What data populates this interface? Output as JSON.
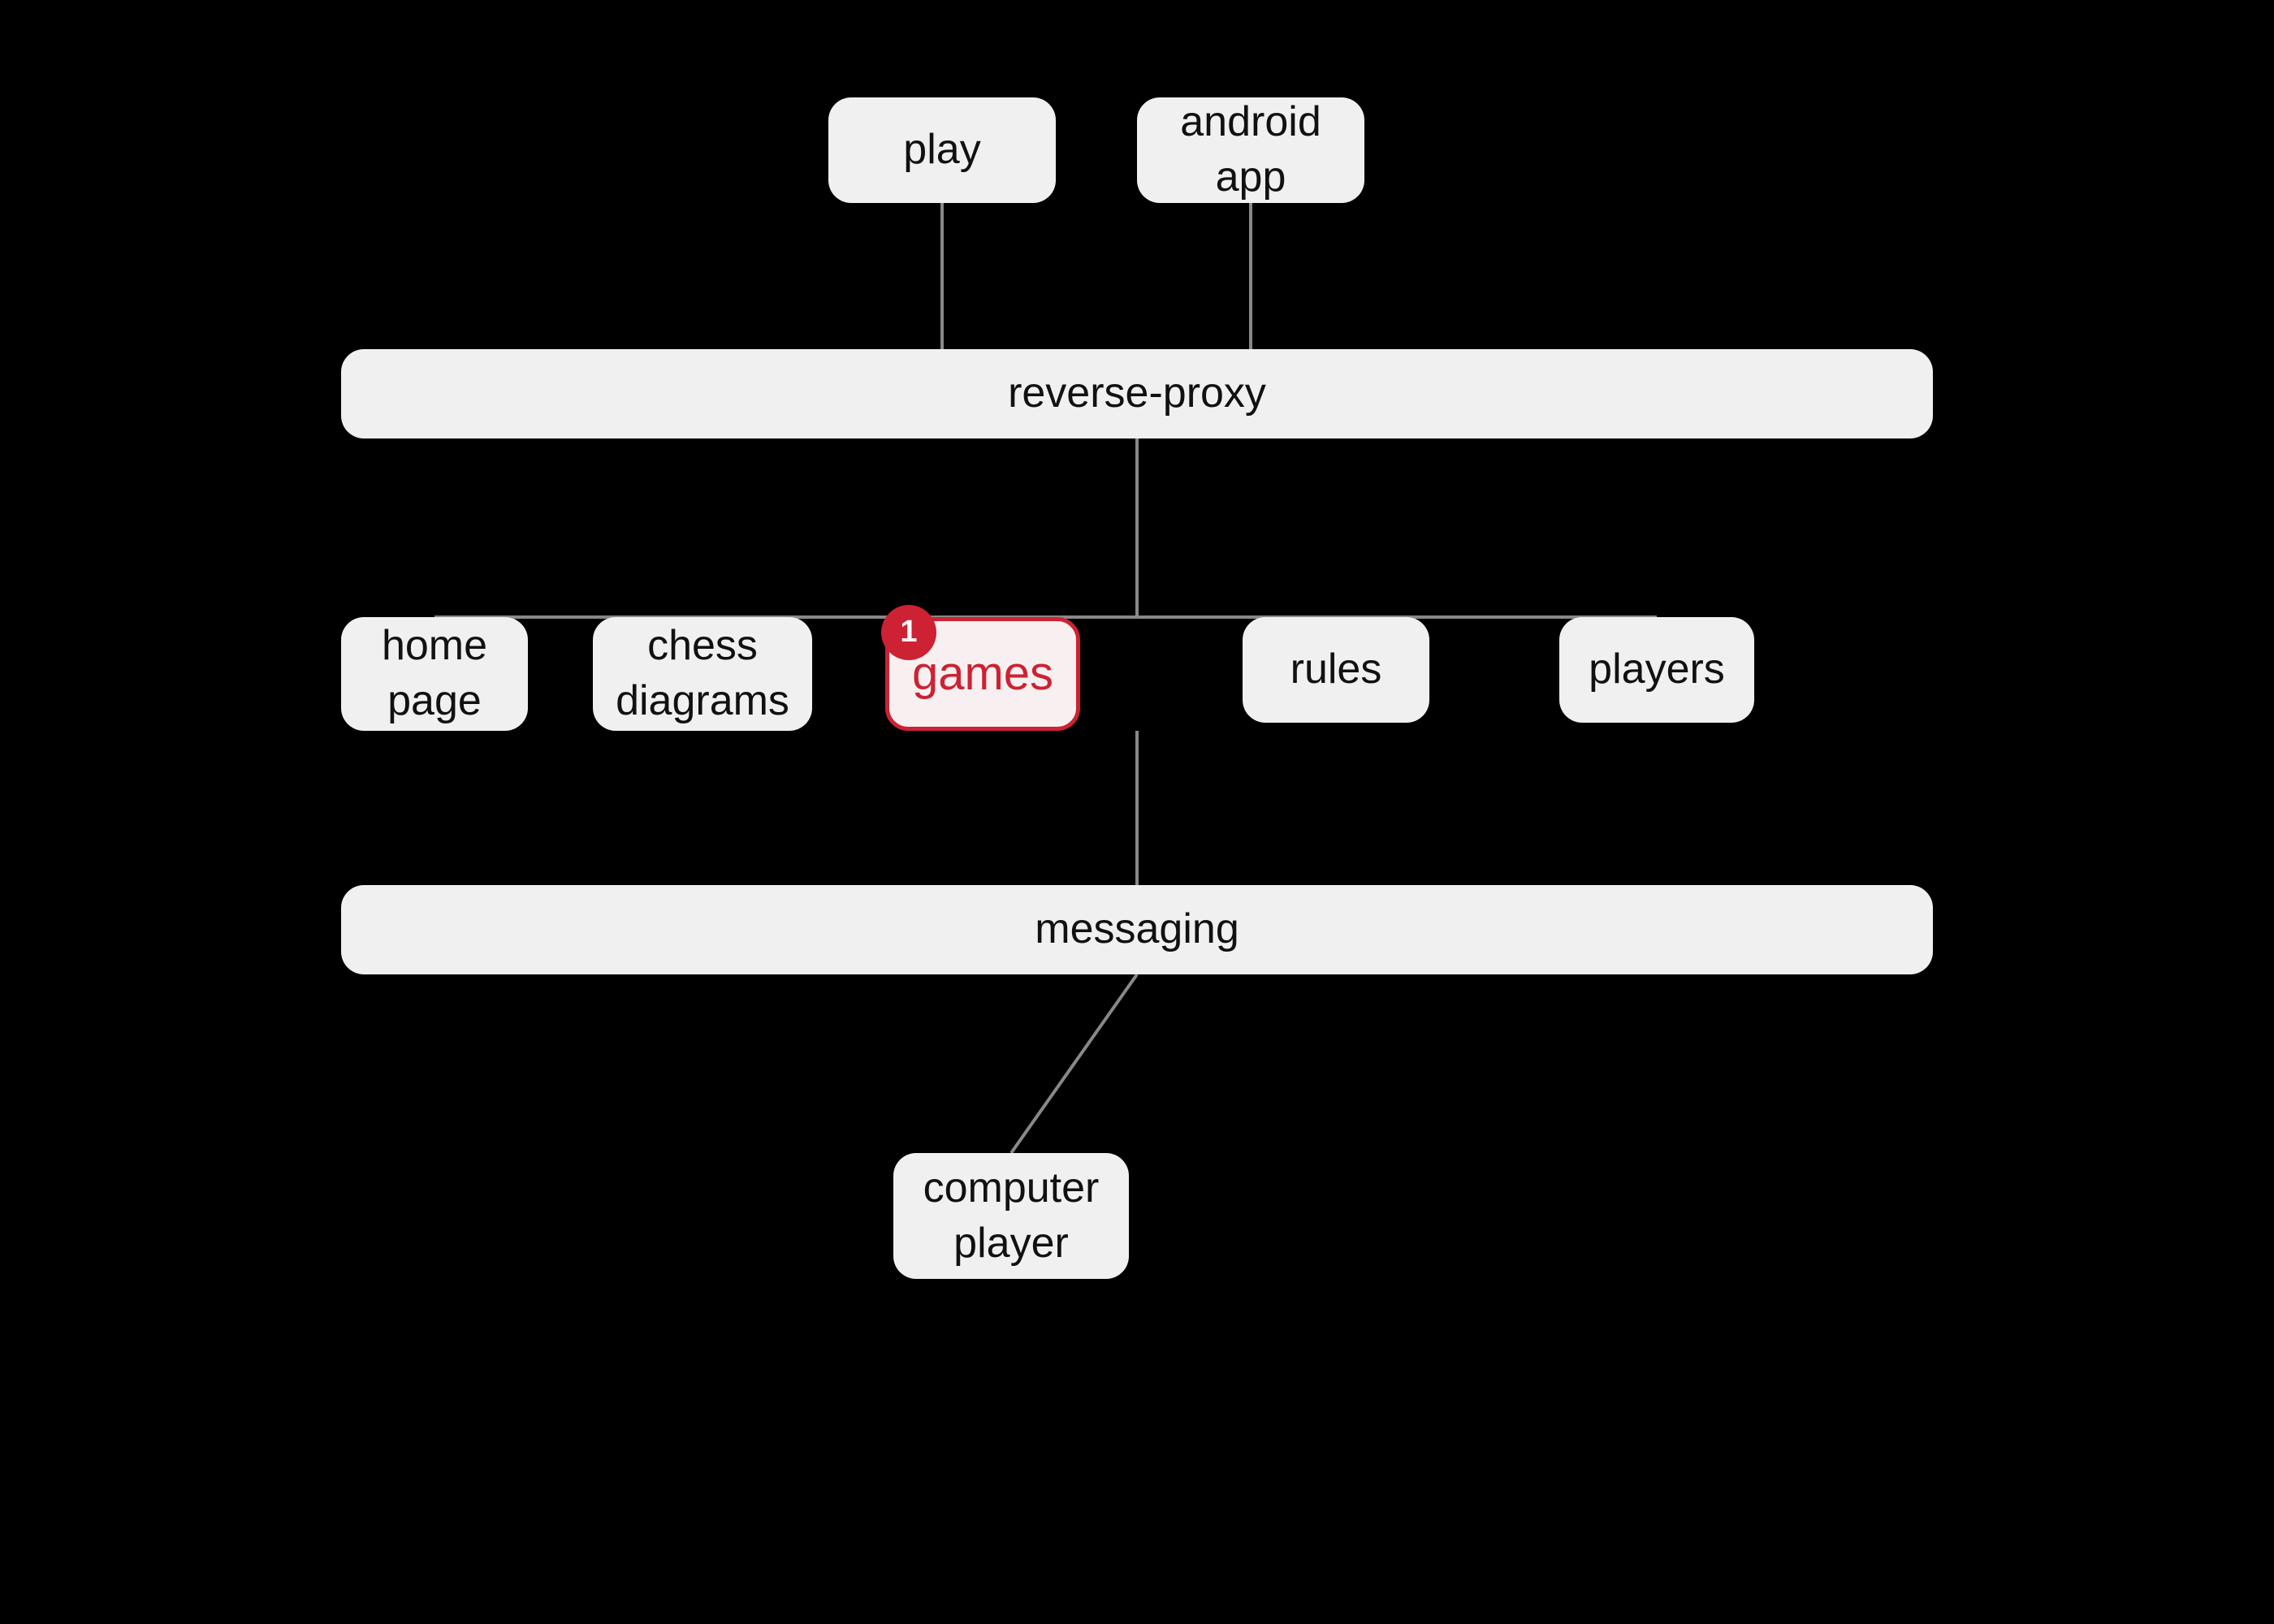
{
  "nodes": {
    "play": {
      "label": "play"
    },
    "android_app": {
      "label": "android\napp"
    },
    "reverse_proxy": {
      "label": "reverse-proxy"
    },
    "home_page": {
      "label": "home\npage"
    },
    "chess_diagrams": {
      "label": "chess\ndiagrams"
    },
    "games": {
      "label": "games",
      "badge": "1"
    },
    "rules": {
      "label": "rules"
    },
    "players": {
      "label": "players"
    },
    "messaging": {
      "label": "messaging"
    },
    "computer_player": {
      "label": "computer\nplayer"
    }
  },
  "colors": {
    "background": "#000000",
    "node_bg": "#f0f0f0",
    "node_text": "#111111",
    "games_border": "#cc2233",
    "games_text": "#cc2233",
    "badge_bg": "#cc2233",
    "badge_text": "#ffffff",
    "connector": "#888888"
  }
}
